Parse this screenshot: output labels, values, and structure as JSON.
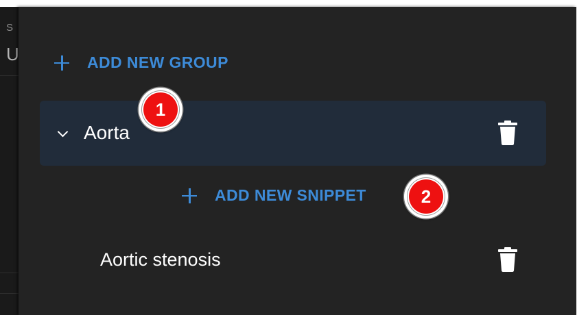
{
  "panel": {
    "add_group_label": "ADD NEW GROUP",
    "groups": [
      {
        "label": "Aorta",
        "expanded": true,
        "add_snippet_label": "ADD NEW SNIPPET",
        "snippets": [
          {
            "label": "Aortic stenosis"
          }
        ]
      }
    ]
  },
  "background_window": {
    "partial_text_top": "S",
    "partial_text_bottom": "U"
  },
  "annotations": [
    {
      "number": "1",
      "target": "group-row"
    },
    {
      "number": "2",
      "target": "add-new-snippet-button"
    }
  ],
  "icons": {
    "add": "plus-icon",
    "expand": "chevron-down-icon",
    "delete": "trash-icon"
  },
  "colors": {
    "panel_background": "#232323",
    "group_row_background": "#212c3a",
    "accent": "#3d8bd8",
    "text": "#ffffff",
    "marker": "#ee1111"
  }
}
